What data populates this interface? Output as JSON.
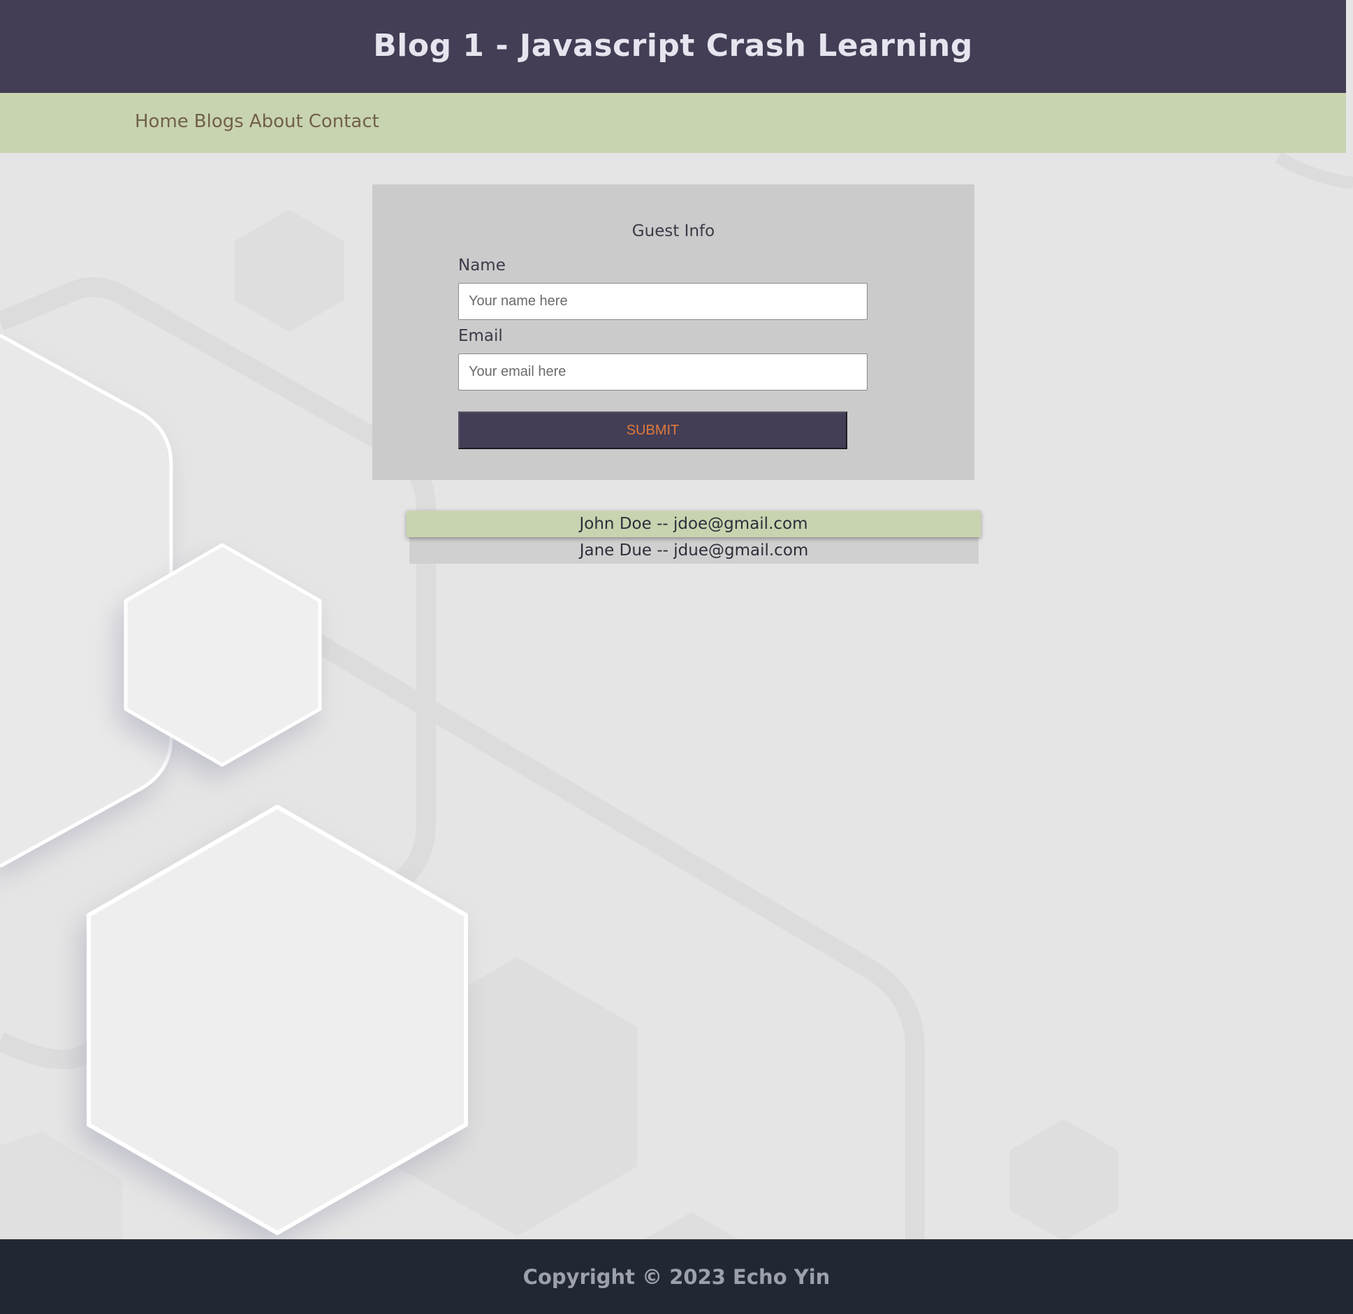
{
  "header": {
    "title": "Blog 1 - Javascript Crash Learning"
  },
  "nav": {
    "items": [
      {
        "label": "Home"
      },
      {
        "label": "Blogs"
      },
      {
        "label": "About"
      },
      {
        "label": "Contact"
      }
    ]
  },
  "form": {
    "title": "Guest Info",
    "name_label": "Name",
    "name_placeholder": "Your name here",
    "email_label": "Email",
    "email_placeholder": "Your email here",
    "submit_label": "SUBMIT"
  },
  "guests": [
    {
      "text": "John Doe -- jdoe@gmail.com"
    },
    {
      "text": "Jane Due -- jdue@gmail.com"
    }
  ],
  "footer": {
    "copyright": "Copyright © 2023 Echo Yin"
  },
  "colors": {
    "header_bg": "#433d55",
    "nav_bg": "#c8d4b0",
    "nav_text": "#72604c",
    "card_bg": "#cbcbcb",
    "submit_text": "#e07a3c",
    "footer_bg": "#222833",
    "page_bg": "#e5e5e5"
  }
}
